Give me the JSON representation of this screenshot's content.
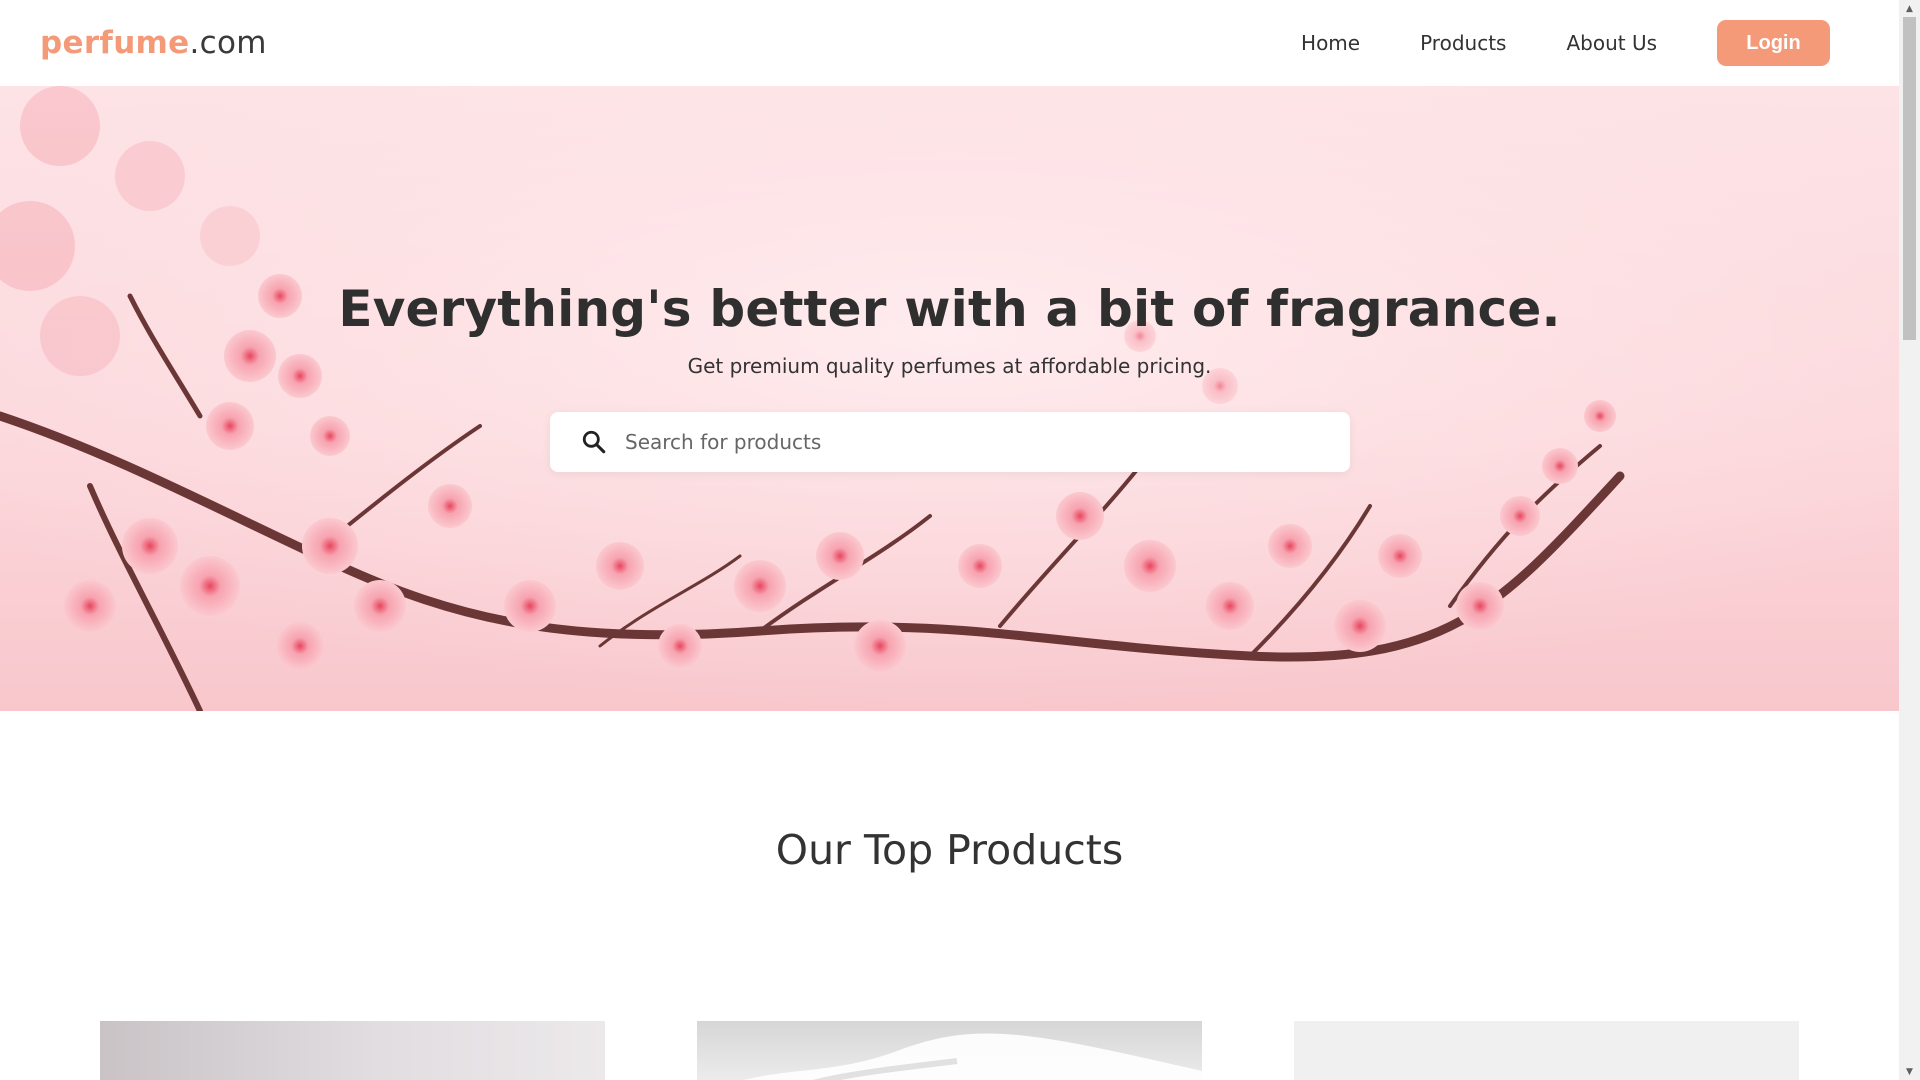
{
  "header": {
    "logo_brand": "perfume",
    "logo_tld": ".com",
    "nav": [
      "Home",
      "Products",
      "About Us"
    ],
    "login_label": "Login"
  },
  "hero": {
    "title": "Everything's better with a bit of fragrance.",
    "subtitle": "Get premium quality perfumes at affordable pricing.",
    "search_placeholder": "Search for products"
  },
  "products": {
    "section_title": "Our Top Products"
  },
  "colors": {
    "accent": "#f49a78",
    "hero_pink": "#fcd8dc",
    "blossom": "#f7b3bc",
    "branch": "#5c2f2f"
  },
  "icons": {
    "search": "search-icon",
    "scroll_up": "chevron-up-icon",
    "scroll_down": "chevron-down-icon"
  }
}
